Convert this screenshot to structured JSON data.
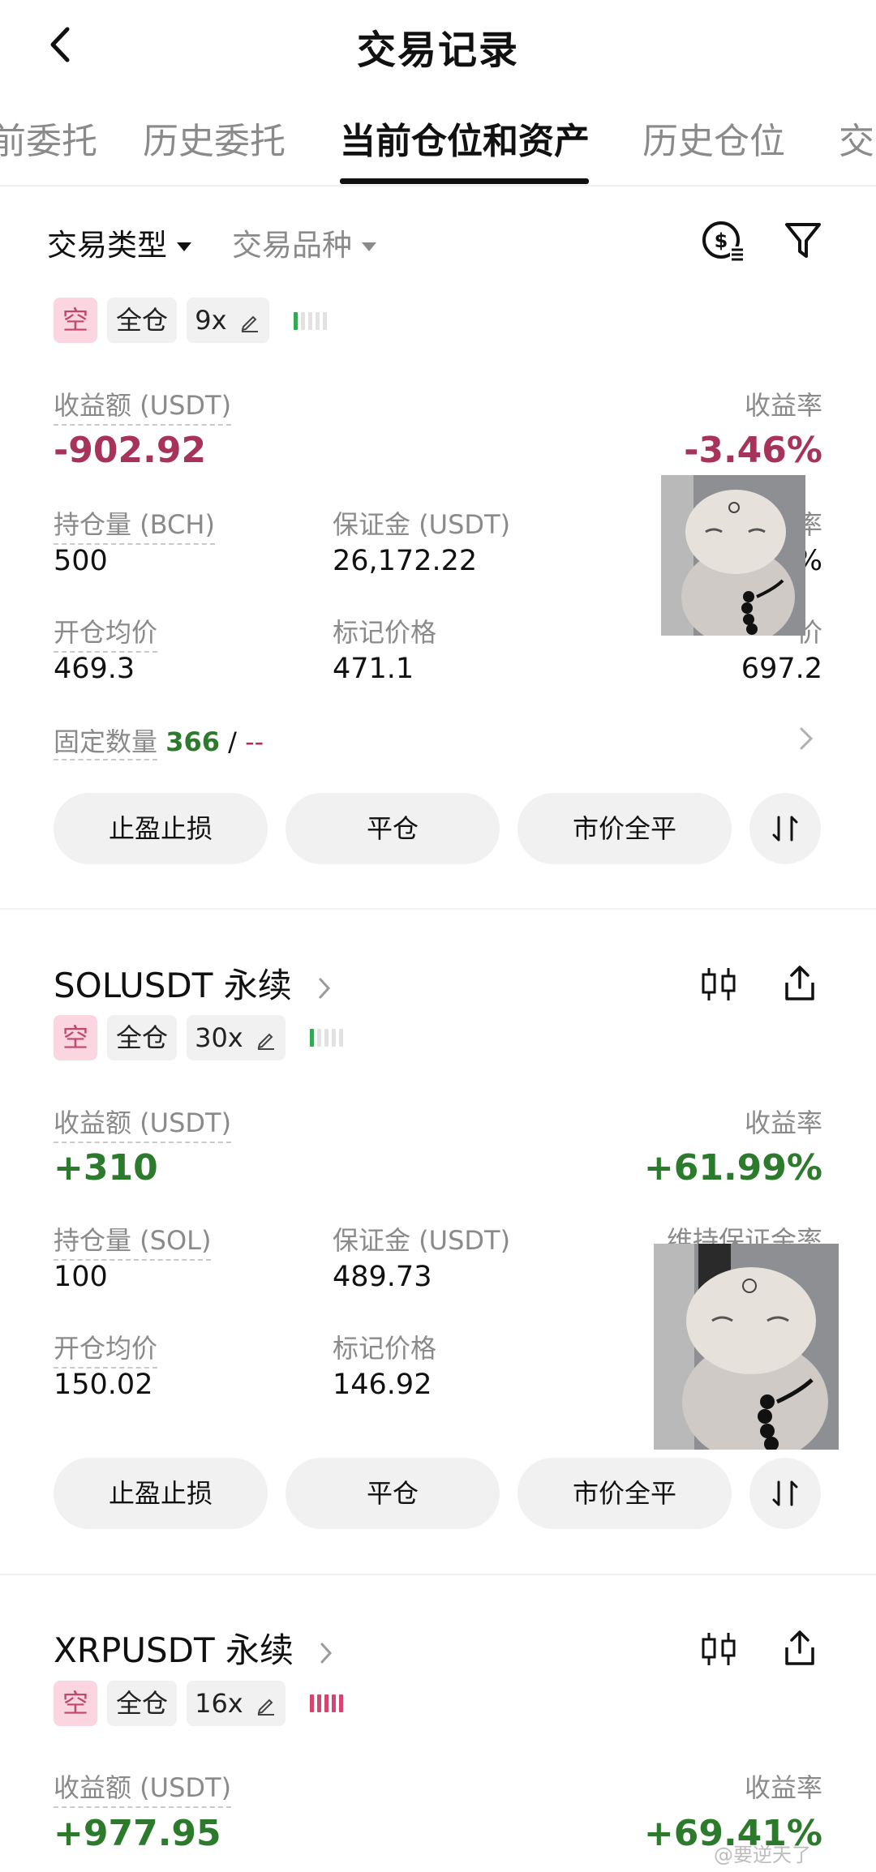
{
  "header": {
    "title": "交易记录",
    "back_icon": "chevron-left-icon"
  },
  "tabs": [
    {
      "label": "前委托",
      "active": false
    },
    {
      "label": "历史委托",
      "active": false
    },
    {
      "label": "当前仓位和资产",
      "active": true
    },
    {
      "label": "历史仓位",
      "active": false
    },
    {
      "label": "交",
      "active": false
    }
  ],
  "filters": {
    "trade_type": "交易类型",
    "trade_symbol": "交易品种",
    "asset_icon": "dollar-list-icon",
    "filter_icon": "funnel-icon"
  },
  "positions": [
    {
      "symbol": "",
      "side": "空",
      "margin_mode": "全仓",
      "leverage": "9x",
      "risk_bars": 1,
      "risk_color": "#34a853",
      "pnl_label": "收益额 (USDT)",
      "pnl_value": "-902.92",
      "roi_label": "收益率",
      "roi_value": "-3.46%",
      "qty_label": "持仓量 (BCH)",
      "qty_value": "500",
      "margin_label": "保证金 (USDT)",
      "margin_value": "26,172.22",
      "maint_label": "率",
      "maint_value": "%",
      "entry_label": "开仓均价",
      "entry_value": "469.3",
      "mark_label": "标记价格",
      "mark_value": "471.1",
      "liq_label": "价",
      "liq_value": "697.2",
      "fixed_label": "固定数量",
      "fixed_qty": "366",
      "fixed_sep": "/",
      "fixed_rest": "--",
      "buttons": {
        "tp_sl": "止盈止损",
        "close": "平仓",
        "market_close": "市价全平",
        "swap_icon": "swap-arrows-icon"
      }
    },
    {
      "symbol": "SOLUSDT 永续",
      "side": "空",
      "margin_mode": "全仓",
      "leverage": "30x",
      "risk_bars": 1,
      "risk_color": "#34a853",
      "pnl_label": "收益额 (USDT)",
      "pnl_value": "+310",
      "roi_label": "收益率",
      "roi_value": "+61.99%",
      "qty_label": "持仓量 (SOL)",
      "qty_value": "100",
      "margin_label": "保证金 (USDT)",
      "margin_value": "489.73",
      "maint_label": "维持保证金率",
      "entry_label": "开仓均价",
      "entry_value": "150.02",
      "mark_label": "标记价格",
      "mark_value": "146.92",
      "buttons": {
        "tp_sl": "止盈止损",
        "close": "平仓",
        "market_close": "市价全平",
        "swap_icon": "swap-arrows-icon"
      }
    },
    {
      "symbol": "XRPUSDT 永续",
      "side": "空",
      "margin_mode": "全仓",
      "leverage": "16x",
      "risk_bars": 5,
      "risk_color": "#d6456f",
      "pnl_label": "收益额 (USDT)",
      "pnl_value": "+977.95",
      "roi_label": "收益率",
      "roi_value": "+69.41%"
    }
  ],
  "icons": {
    "chart": "candlestick-icon",
    "share": "share-icon",
    "chevron": "chevron-right-icon"
  },
  "watermark": "@要逆天了"
}
